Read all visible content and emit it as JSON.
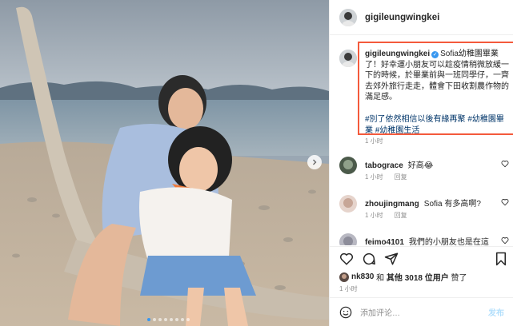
{
  "post": {
    "username": "gigileungwingkei",
    "verified": true,
    "caption": "Sofia幼稚園畢業了！好幸運小朋友可以趁疫情稍微放緩一下的時候，於畢業前與一班同學仔，一齊去郊外旅行走走，體會下田收割農作物的滿足感。",
    "hashtags": "#別了依然相信以後有緣再聚 #幼稚園畢業 #幼稚園生活",
    "caption_time": "1 小时",
    "likes": {
      "liker": "nk830",
      "connector": "和",
      "others": "其他 3018 位用户",
      "suffix": "赞了"
    },
    "post_time": "1 小时",
    "add_comment_placeholder": "添加评论…",
    "post_button": "发布"
  },
  "comments": [
    {
      "username": "tabograce",
      "text": "好高😂",
      "time": "1 小时",
      "reply": "回复"
    },
    {
      "username": "zhoujingmang",
      "text": "Sofia 有多高啊?",
      "time": "1 小时",
      "reply": "回复"
    },
    {
      "username": "feimo4101",
      "text": "我們的小朋友也是在這"
    }
  ],
  "carousel": {
    "total": 8,
    "active": 0
  },
  "colors": {
    "highlight_box": "#f45a3c",
    "verified_badge": "#3897f0",
    "hashtag": "#003569",
    "muted": "#8e8e8e"
  },
  "icons": [
    "verified-badge-icon",
    "heart-icon",
    "comment-icon",
    "share-icon",
    "bookmark-icon",
    "smiley-icon",
    "chevron-right-icon"
  ]
}
